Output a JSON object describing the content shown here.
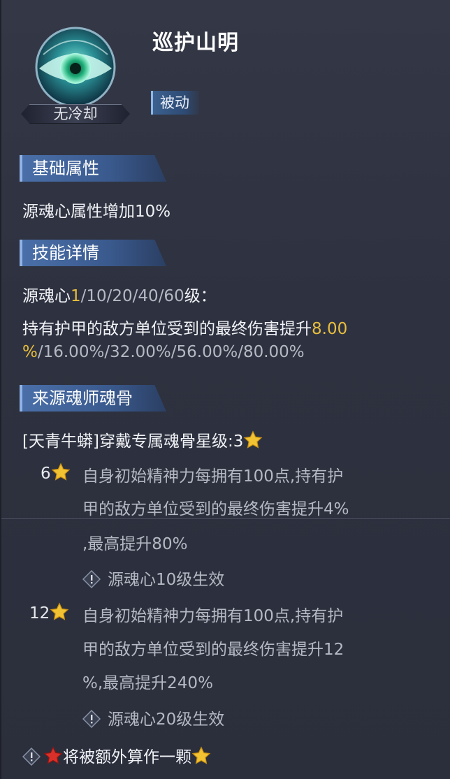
{
  "skill": {
    "name": "巡护山明",
    "cooldown": "无冷却",
    "type": "被动"
  },
  "sections": {
    "basic_header": "基础属性",
    "basic_text": "源魂心属性增加10%",
    "detail_header": "技能详情",
    "detail_prefix": "源魂心",
    "detail_current_level": "1",
    "detail_other_levels": "/10/20/40/60",
    "detail_suffix": "级：",
    "detail_text": "持有护甲的敌方单位受到的最终伤害提升",
    "detail_value_current_a": "8.00",
    "detail_value_current_b": "%",
    "detail_values_rest": "/16.00%/32.00%/56.00%/80.00%",
    "source_header": "来源魂师魂骨",
    "source_title": "[天青牛蟒]穿戴专属魂骨星级:3"
  },
  "bonuses": [
    {
      "level": "6",
      "line1": "自身初始精神力每拥有100点,持有护",
      "line2": "甲的敌方单位受到的最终伤害提升4%",
      "line3": ",最高提升80%",
      "condition": "源魂心10级生效"
    },
    {
      "level": "12",
      "line1": "自身初始精神力每拥有100点,持有护",
      "line2": "甲的敌方单位受到的最终伤害提升12",
      "line3": "%,最高提升240%",
      "condition": "源魂心20级生效"
    }
  ],
  "footer": {
    "note": "将被额外算作一颗"
  },
  "colors": {
    "highlight": "#e7be3e",
    "section_blue": "#4a6fa8",
    "star_gold": "#f1c232",
    "star_red": "#d9302a"
  },
  "icons": [
    "eye-skill-icon",
    "star-icon",
    "red-star-icon",
    "info-diamond-icon"
  ]
}
